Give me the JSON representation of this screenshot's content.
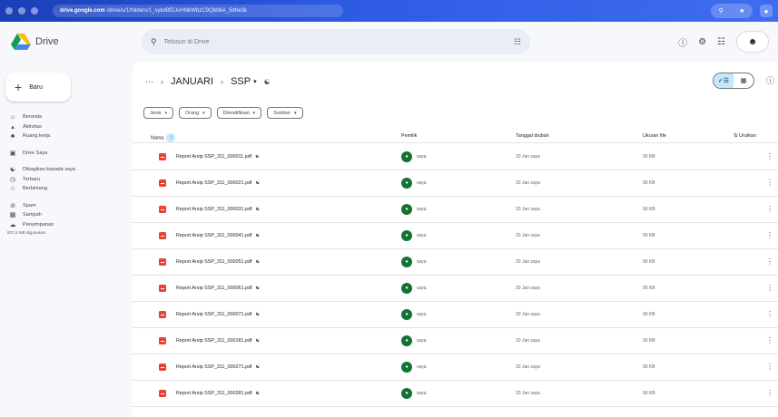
{
  "browser": {
    "url_host": "drive.google.com",
    "url_path": "/drive/u/1/folders/1_sykd8fDJuHNbWbzC9Qbb6A_5dhe3k"
  },
  "header": {
    "app_name": "Drive",
    "search_placeholder": "Telusuri di Drive"
  },
  "sidebar": {
    "new_label": "Baru",
    "items": [
      {
        "label": "Beranda",
        "icon": "home-icon"
      },
      {
        "label": "Aktivitas",
        "icon": "activity-icon"
      },
      {
        "label": "Ruang kerja",
        "icon": "workspaces-icon"
      },
      {
        "label": "Drive Saya",
        "icon": "my-drive-icon"
      },
      {
        "label": "Dibagikan kepada saya",
        "icon": "shared-with-me-icon"
      },
      {
        "label": "Terbaru",
        "icon": "recent-icon"
      },
      {
        "label": "Berbintang",
        "icon": "starred-icon"
      },
      {
        "label": "Spam",
        "icon": "spam-icon"
      },
      {
        "label": "Sampah",
        "icon": "trash-icon"
      },
      {
        "label": "Penyimpanan",
        "icon": "storage-icon"
      }
    ],
    "storage_used": "837,6 MB digunakan"
  },
  "breadcrumb": {
    "parent": "JANUARI",
    "current": "SSP"
  },
  "filters": [
    "Jenis",
    "Orang",
    "Dimodifikasi",
    "Sumber"
  ],
  "table": {
    "columns": {
      "name": "Nama",
      "owner": "Pemilik",
      "modified": "Tanggal diubah",
      "size": "Ukuran file",
      "sort": "Urutkan"
    },
    "rows": [
      {
        "name": "Report Arsip SSP_311_000011.pdf",
        "owner": "saya",
        "modified": "20 Jan saya",
        "size": "90 KB"
      },
      {
        "name": "Report Arsip SSP_311_000021.pdf",
        "owner": "saya",
        "modified": "20 Jan saya",
        "size": "90 KB"
      },
      {
        "name": "Report Arsip SSP_311_000031.pdf",
        "owner": "saya",
        "modified": "20 Jan saya",
        "size": "90 KB"
      },
      {
        "name": "Report Arsip SSP_311_000041.pdf",
        "owner": "saya",
        "modified": "20 Jan saya",
        "size": "90 KB"
      },
      {
        "name": "Report Arsip SSP_311_000051.pdf",
        "owner": "saya",
        "modified": "20 Jan saya",
        "size": "90 KB"
      },
      {
        "name": "Report Arsip SSP_311_000061.pdf",
        "owner": "saya",
        "modified": "20 Jan saya",
        "size": "90 KB"
      },
      {
        "name": "Report Arsip SSP_311_000071.pdf",
        "owner": "saya",
        "modified": "20 Jan saya",
        "size": "90 KB"
      },
      {
        "name": "Report Arsip SSP_311_000181.pdf",
        "owner": "saya",
        "modified": "20 Jan saya",
        "size": "90 KB"
      },
      {
        "name": "Report Arsip SSP_311_000271.pdf",
        "owner": "saya",
        "modified": "20 Jan saya",
        "size": "90 KB"
      },
      {
        "name": "Report Arsip SSP_311_000281.pdf",
        "owner": "saya",
        "modified": "20 Jan saya",
        "size": "90 KB"
      }
    ]
  },
  "colors": {
    "accent": "#0b57d0",
    "selected": "#c2e7ff",
    "pdf": "#ea4335",
    "owner_avatar": "#137333",
    "background": "#f6f8fc"
  }
}
